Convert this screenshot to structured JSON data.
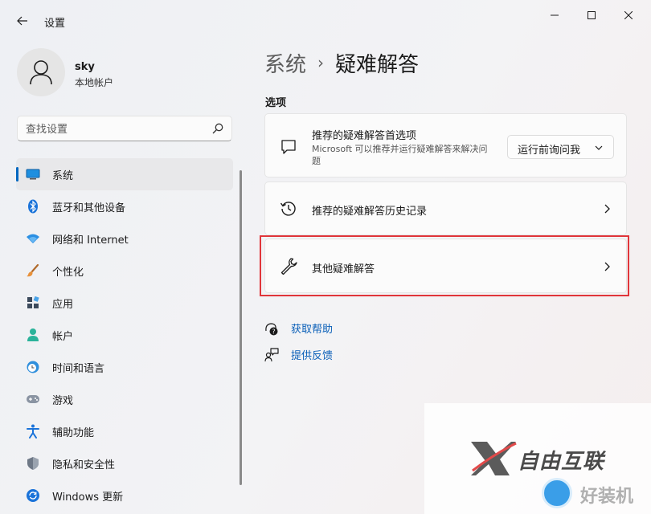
{
  "app": {
    "title": "设置"
  },
  "user": {
    "name": "sky",
    "account_type": "本地帐户"
  },
  "search": {
    "placeholder": "查找设置"
  },
  "sidebar": {
    "items": [
      {
        "label": "系统",
        "icon": "monitor-icon",
        "active": true
      },
      {
        "label": "蓝牙和其他设备",
        "icon": "bluetooth-icon"
      },
      {
        "label": "网络和 Internet",
        "icon": "wifi-icon"
      },
      {
        "label": "个性化",
        "icon": "brush-icon"
      },
      {
        "label": "应用",
        "icon": "apps-icon"
      },
      {
        "label": "帐户",
        "icon": "account-icon"
      },
      {
        "label": "时间和语言",
        "icon": "clock-globe-icon"
      },
      {
        "label": "游戏",
        "icon": "gamepad-icon"
      },
      {
        "label": "辅助功能",
        "icon": "accessibility-icon"
      },
      {
        "label": "隐私和安全性",
        "icon": "shield-icon"
      },
      {
        "label": "Windows 更新",
        "icon": "update-icon"
      }
    ]
  },
  "breadcrumb": {
    "parent": "系统",
    "separator": "›",
    "current": "疑难解答"
  },
  "main": {
    "section_label": "选项",
    "cards": [
      {
        "title": "推荐的疑难解答首选项",
        "description": "Microsoft 可以推荐并运行疑难解答来解决问题",
        "dropdown_value": "运行前询问我",
        "icon": "message-icon"
      },
      {
        "title": "推荐的疑难解答历史记录",
        "icon": "history-icon"
      },
      {
        "title": "其他疑难解答",
        "icon": "wrench-icon"
      }
    ],
    "links": [
      {
        "label": "获取帮助",
        "icon": "help-icon"
      },
      {
        "label": "提供反馈",
        "icon": "feedback-icon"
      }
    ]
  },
  "watermark": {
    "brand": "自由互联",
    "secondary": "好装机"
  },
  "colors": {
    "accent": "#0067c0",
    "link": "#0a5fb8",
    "highlight": "#e0353a"
  }
}
